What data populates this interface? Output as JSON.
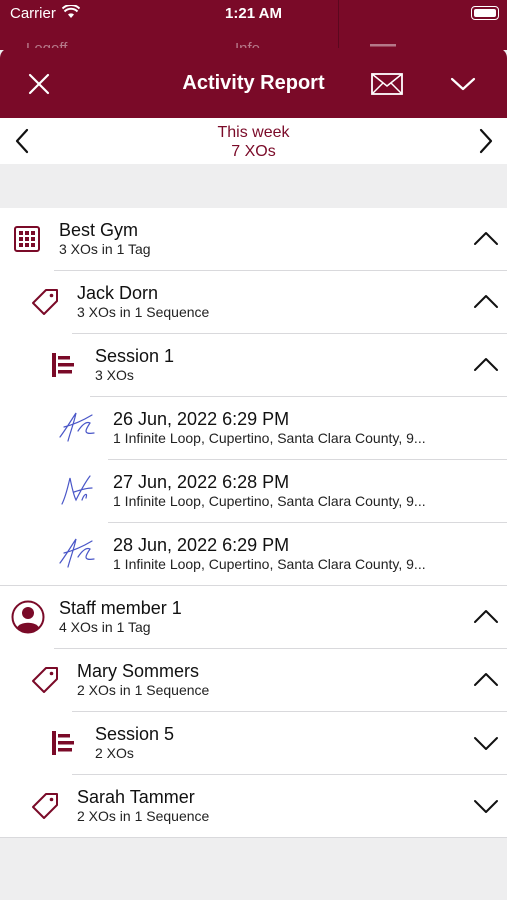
{
  "status": {
    "carrier": "Carrier",
    "time": "1:21 AM"
  },
  "behind": {
    "left_tab": "Logoff",
    "mid_tab": "Info"
  },
  "header": {
    "title": "Activity Report"
  },
  "week": {
    "label": "This week",
    "count": "7 XOs"
  },
  "groups": [
    {
      "title": "Best Gym",
      "subtitle": "3 XOs in 1 Tag"
    },
    {
      "title": "Jack Dorn",
      "subtitle": "3 XOs in 1 Sequence"
    },
    {
      "title": "Session 1",
      "subtitle": "3 XOs"
    },
    {
      "title": "Staff member 1",
      "subtitle": "4 XOs in 1 Tag"
    },
    {
      "title": "Mary Sommers",
      "subtitle": "2 XOs in 1 Sequence"
    },
    {
      "title": "Session 5",
      "subtitle": "2 XOs"
    },
    {
      "title": "Sarah Tammer",
      "subtitle": "2 XOs in 1 Sequence"
    }
  ],
  "xos": [
    {
      "datetime": "26 Jun, 2022  6:29 PM",
      "address": "1 Infinite Loop, Cupertino, Santa Clara County, 9..."
    },
    {
      "datetime": "27 Jun, 2022  6:28 PM",
      "address": "1 Infinite Loop, Cupertino, Santa Clara County, 9..."
    },
    {
      "datetime": "28 Jun, 2022  6:29 PM",
      "address": "1 Infinite Loop, Cupertino, Santa Clara County, 9..."
    }
  ],
  "colors": {
    "brand": "#7a0a28",
    "signature": "#4a57c8"
  }
}
